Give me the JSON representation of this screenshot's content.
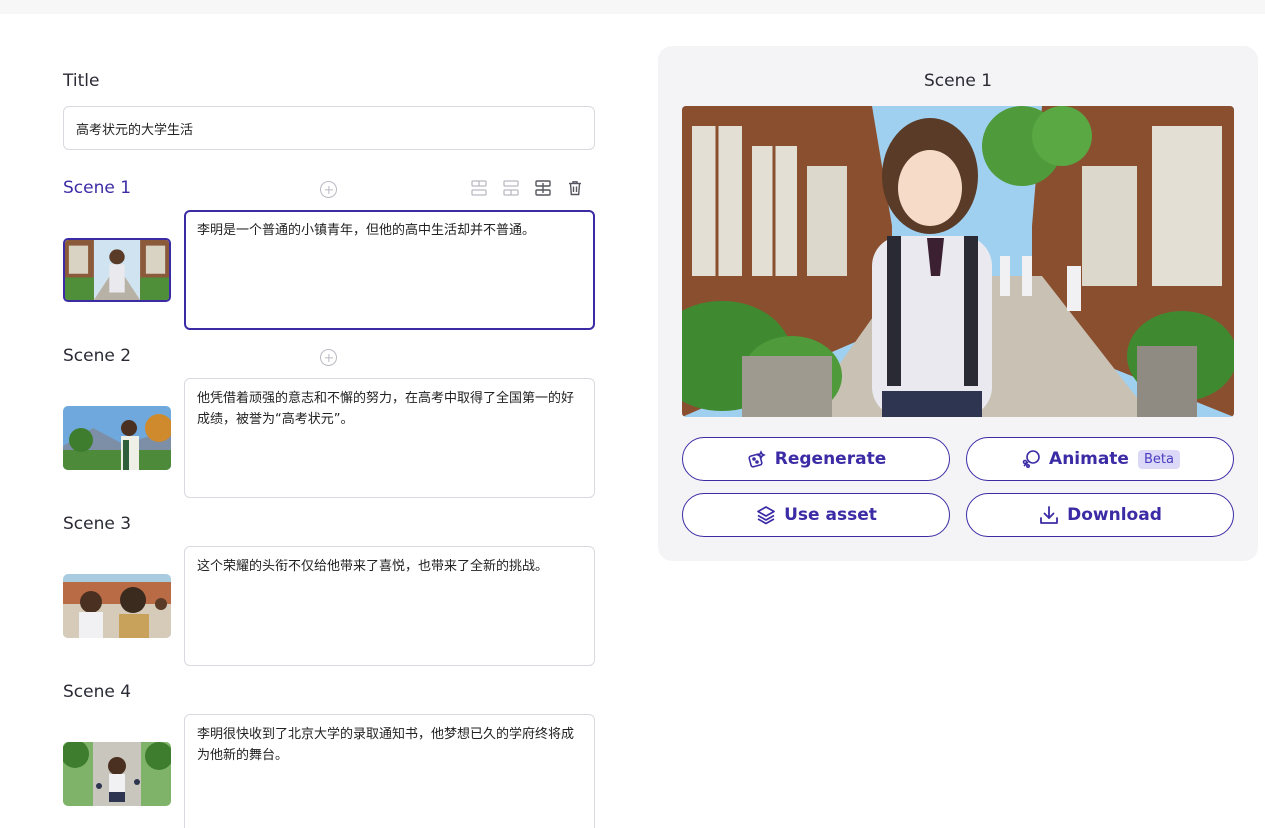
{
  "form": {
    "title_label": "Title",
    "title_value": "高考状元的大学生活"
  },
  "scenes": [
    {
      "label": "Scene 1",
      "text": "李明是一个普通的小镇青年，但他的高中生活却并不普通。",
      "active": true
    },
    {
      "label": "Scene 2",
      "text": "他凭借着顽强的意志和不懈的努力，在高考中取得了全国第一的好成绩，被誉为“高考状元”。",
      "active": false
    },
    {
      "label": "Scene 3",
      "text": "这个荣耀的头衔不仅给他带来了喜悦，也带来了全新的挑战。",
      "active": false
    },
    {
      "label": "Scene 4",
      "text": "李明很快收到了北京大学的录取通知书，他梦想已久的学府终将成为他新的舞台。",
      "active": false
    }
  ],
  "preview": {
    "title": "Scene 1",
    "regenerate_label": "Regenerate",
    "animate_label": "Animate",
    "beta_badge": "Beta",
    "use_asset_label": "Use asset",
    "download_label": "Download"
  },
  "theme": {
    "accent": "#3b2ca6",
    "panel_bg": "#f4f4f6",
    "border": "#d9d9df"
  }
}
